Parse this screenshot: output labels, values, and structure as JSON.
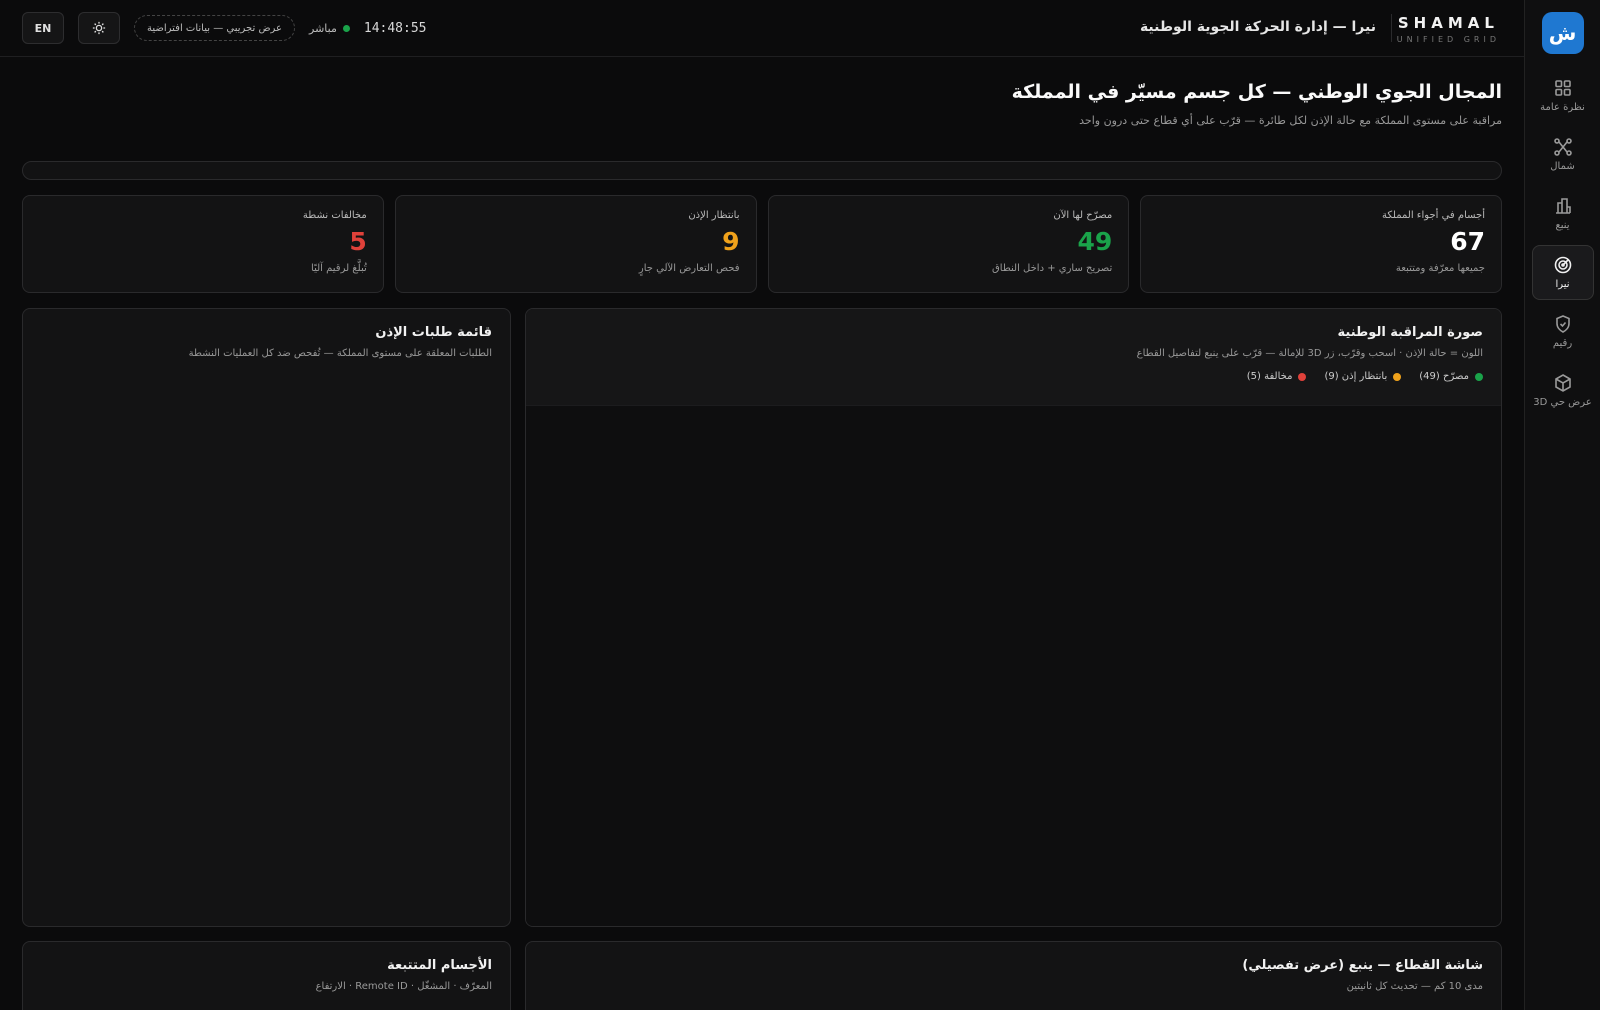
{
  "sidebar": {
    "logo": "ش",
    "items": [
      {
        "label": "نظرة عامة",
        "icon": "grid-icon",
        "active": false
      },
      {
        "label": "شمال",
        "icon": "network-icon",
        "active": false
      },
      {
        "label": "ينبع",
        "icon": "buildings-icon",
        "active": false
      },
      {
        "label": "نيرا",
        "icon": "radar-icon",
        "active": true
      },
      {
        "label": "رقيم",
        "icon": "shield-icon",
        "active": false
      },
      {
        "label": "عرض حي 3D",
        "icon": "cube-icon",
        "active": false
      }
    ]
  },
  "topbar": {
    "brand_name": "SHAMAL",
    "brand_sub": "UNIFIED GRID",
    "app_title": "نيرا — إدارة الحركة الجوية الوطنية",
    "clock": "14:48:55",
    "live_label": "مباشر",
    "demo_label": "عرض تجريبي — بيانات افتراضية",
    "lang_button": "EN",
    "theme_icon": "sun-icon"
  },
  "page": {
    "title": "المجال الجوي الوطني — كل جسم مسيّر في المملكة",
    "subtitle": "مراقبة على مستوى المملكة مع حالة الإذن لكل طائرة — قرّب على أي قطاع حتى درون واحد"
  },
  "stats": [
    {
      "label": "أجسام في أجواء المملكة",
      "value": "67",
      "note": "جميعها معرّفة ومتتبعة",
      "color": "#ffffff"
    },
    {
      "label": "مصرّح لها الآن",
      "value": "49",
      "note": "تصريح ساري + داخل النطاق",
      "color": "#1aa34a"
    },
    {
      "label": "بانتظار الإذن",
      "value": "9",
      "note": "فحص التعارض الآلي جارٍ",
      "color": "#f0a21b"
    },
    {
      "label": "مخالفات نشطة",
      "value": "5",
      "note": "تُبلَّغ لرقيم آليًا",
      "color": "#e0413a"
    }
  ],
  "surveillance": {
    "title": "صورة المراقبة الوطنية",
    "subtitle": "اللون = حالة الإذن · اسحب وقرّب، زر 3D للإمالة — قرّب على ينبع لتفاصيل القطاع",
    "legend": [
      {
        "label": "مصرّح (49)",
        "color": "#1aa34a"
      },
      {
        "label": "بانتظار إذن (9)",
        "color": "#f0a21b"
      },
      {
        "label": "مخالفة (5)",
        "color": "#e0413a"
      }
    ]
  },
  "requests": {
    "title": "قائمة طلبات الإذن",
    "subtitle": "الطلبات المعلقة على مستوى المملكة — تُفحص ضد كل العمليات النشطة"
  },
  "sector": {
    "title": "شاشة القطاع — ينبع (عرض تفصيلي)",
    "subtitle": "مدى 10 كم — تحديث كل ثانيتين"
  },
  "tracked": {
    "title": "الأجسام المتتبعة",
    "subtitle": "المعرّف · المشغّل · Remote ID · الارتفاع"
  }
}
